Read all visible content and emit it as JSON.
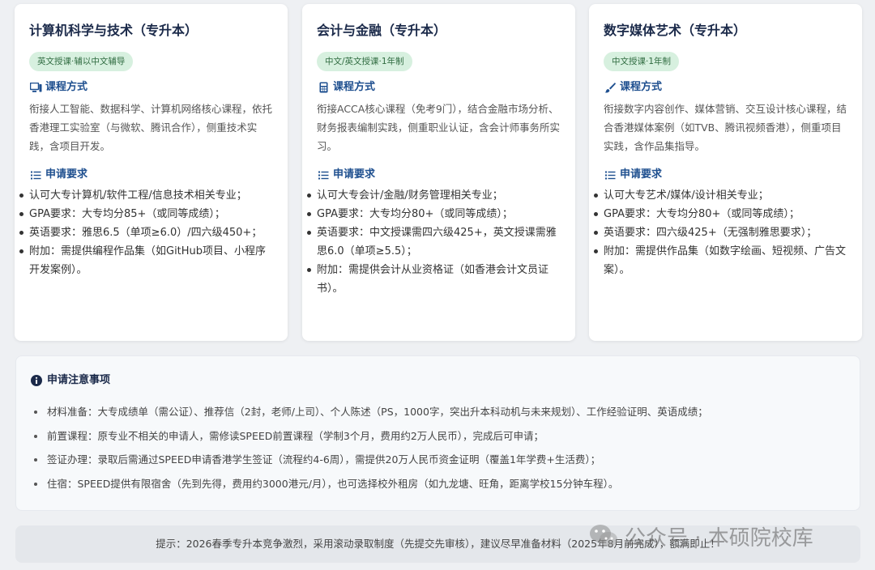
{
  "cards": [
    {
      "title": "计算机科学与技术（专升本）",
      "badge": "英文授课·辅以中文辅导",
      "course_icon": "monitor-icon",
      "course_heading": "课程方式",
      "course_desc": "衔接人工智能、数据科学、计算机网络核心课程，依托香港理工实验室（与微软、腾讯合作），侧重技术实践，含项目开发。",
      "req_icon": "list-icon",
      "req_heading": "申请要求",
      "requirements": [
        "认可大专计算机/软件工程/信息技术相关专业；",
        "GPA要求：大专均分85+（或同等成绩）；",
        "英语要求：雅思6.5（单项≥6.0）/四六级450+；",
        "附加：需提供编程作品集（如GitHub项目、小程序开发案例）。"
      ]
    },
    {
      "title": "会计与金融（专升本）",
      "badge": "中文/英文授课·1年制",
      "course_icon": "calculator-icon",
      "course_heading": "课程方式",
      "course_desc": "衔接ACCA核心课程（免考9门），结合金融市场分析、财务报表编制实践，侧重职业认证，含会计师事务所实习。",
      "req_icon": "list-icon",
      "req_heading": "申请要求",
      "requirements": [
        "认可大专会计/金融/财务管理相关专业；",
        "GPA要求：大专均分80+（或同等成绩）；",
        "英语要求：中文授课需四六级425+，英文授课需雅思6.0（单项≥5.5）；",
        "附加：需提供会计从业资格证（如香港会计文员证书）。"
      ]
    },
    {
      "title": "数字媒体艺术（专升本）",
      "badge": "中文授课·1年制",
      "course_icon": "paintbrush-icon",
      "course_heading": "课程方式",
      "course_desc": "衔接数字内容创作、媒体营销、交互设计核心课程，结合香港媒体案例（如TVB、腾讯视频香港），侧重项目实践，含作品集指导。",
      "req_icon": "list-icon",
      "req_heading": "申请要求",
      "requirements": [
        "认可大专艺术/媒体/设计相关专业；",
        "GPA要求：大专均分80+（或同等成绩）；",
        "英语要求：四六级425+（无强制雅思要求）；",
        "附加：需提供作品集（如数字绘画、短视频、广告文案）。"
      ]
    }
  ],
  "notice": {
    "icon": "info-icon",
    "title": "申请注意事项",
    "items": [
      "材料准备：大专成绩单（需公证）、推荐信（2封，老师/上司）、个人陈述（PS，1000字，突出升本科动机与未来规划）、工作经验证明、英语成绩；",
      "前置课程：原专业不相关的申请人，需修读SPEED前置课程（学制3个月，费用约2万人民币），完成后可申请；",
      "签证办理：录取后需通过SPEED申请香港学生签证（流程约4-6周），需提供20万人民币资金证明（覆盖1年学费+生活费）；",
      "住宿：SPEED提供有限宿舍（先到先得，费用约3000港元/月），也可选择校外租房（如九龙塘、旺角，距离学校15分钟车程）。"
    ]
  },
  "tip": "提示：2026春季专升本竞争激烈，采用滚动录取制度（先提交先审核），建议尽早准备材料（2025年8月前完成），额满即止！",
  "watermark": {
    "icon": "wechat-icon",
    "text": "公众号 · 本硕院校库"
  },
  "colors": {
    "heading_blue": "#1e4f8f",
    "badge_bg": "#d7f0df",
    "badge_text": "#2f6b40",
    "page_bg": "#eef0f3"
  }
}
